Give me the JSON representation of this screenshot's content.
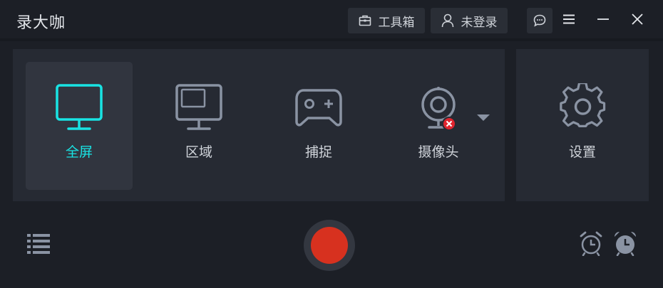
{
  "app": {
    "title": "录大咖"
  },
  "toolbar": {
    "toolbox_label": "工具箱",
    "login_label": "未登录"
  },
  "modes": [
    {
      "label": "全屏",
      "icon": "monitor-icon"
    },
    {
      "label": "区域",
      "icon": "region-monitor-icon"
    },
    {
      "label": "捕捉",
      "icon": "gamepad-icon"
    },
    {
      "label": "摄像头",
      "icon": "webcam-icon"
    }
  ],
  "settings": {
    "label": "设置",
    "icon": "gear-icon"
  },
  "colors": {
    "accent": "#19e3e3",
    "record": "#d7311f",
    "icon": "#8a93a3",
    "error_badge": "#e0242e"
  }
}
